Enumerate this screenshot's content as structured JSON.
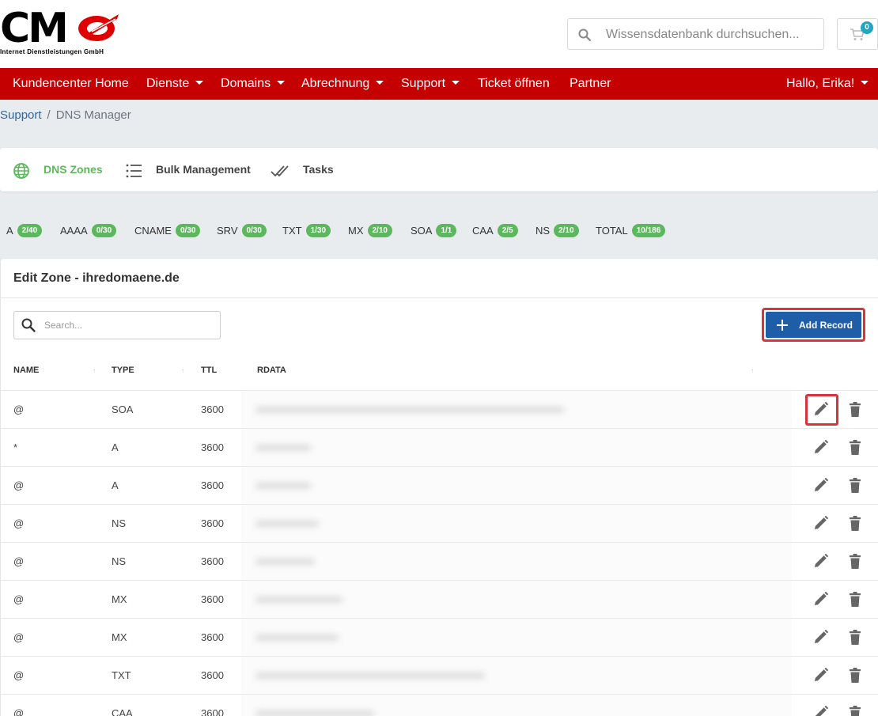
{
  "logo": {
    "text": "CM",
    "subtitle": "Internet Dienstleistungen GmbH"
  },
  "search": {
    "placeholder": "Wissensdatenbank durchsuchen..."
  },
  "cart": {
    "count": "0"
  },
  "nav": {
    "items": [
      {
        "label": "Kundencenter Home",
        "dropdown": false
      },
      {
        "label": "Dienste",
        "dropdown": true
      },
      {
        "label": "Domains",
        "dropdown": true
      },
      {
        "label": "Abrechnung",
        "dropdown": true
      },
      {
        "label": "Support",
        "dropdown": true
      },
      {
        "label": "Ticket öffnen",
        "dropdown": false
      },
      {
        "label": "Partner",
        "dropdown": false
      }
    ],
    "user_greeting": "Hallo, Erika!"
  },
  "breadcrumb": {
    "parent": "Support",
    "separator": "/",
    "current": "DNS Manager"
  },
  "tabs": [
    {
      "label": "DNS Zones",
      "icon": "globe-icon",
      "active": true
    },
    {
      "label": "Bulk Management",
      "icon": "list-icon",
      "active": false
    },
    {
      "label": "Tasks",
      "icon": "double-check-icon",
      "active": false
    }
  ],
  "record_counts": [
    {
      "type": "A",
      "count": "2/40"
    },
    {
      "type": "AAAA",
      "count": "0/30"
    },
    {
      "type": "CNAME",
      "count": "0/30"
    },
    {
      "type": "SRV",
      "count": "0/30"
    },
    {
      "type": "TXT",
      "count": "1/30"
    },
    {
      "type": "MX",
      "count": "2/10"
    },
    {
      "type": "SOA",
      "count": "1/1"
    },
    {
      "type": "CAA",
      "count": "2/5"
    },
    {
      "type": "NS",
      "count": "2/10"
    },
    {
      "type": "TOTAL",
      "count": "10/186"
    }
  ],
  "zone": {
    "title": "Edit Zone - ihredomaene.de",
    "search_placeholder": "Search...",
    "add_record_label": "Add Record",
    "columns": [
      "NAME",
      "TYPE",
      "TTL",
      "RDATA"
    ],
    "rows": [
      {
        "name": "@",
        "type": "SOA",
        "ttl": "3600"
      },
      {
        "name": "*",
        "type": "A",
        "ttl": "3600"
      },
      {
        "name": "@",
        "type": "A",
        "ttl": "3600"
      },
      {
        "name": "@",
        "type": "NS",
        "ttl": "3600"
      },
      {
        "name": "@",
        "type": "NS",
        "ttl": "3600"
      },
      {
        "name": "@",
        "type": "MX",
        "ttl": "3600"
      },
      {
        "name": "@",
        "type": "MX",
        "ttl": "3600"
      },
      {
        "name": "@",
        "type": "TXT",
        "ttl": "3600"
      },
      {
        "name": "@",
        "type": "CAA",
        "ttl": "3600"
      }
    ]
  },
  "colors": {
    "nav_bg": "#c40000",
    "accent_green": "#5cb85c",
    "primary_button": "#1e5ea8",
    "highlight_border": "#d9343a",
    "cart_badge": "#22a7c1"
  }
}
